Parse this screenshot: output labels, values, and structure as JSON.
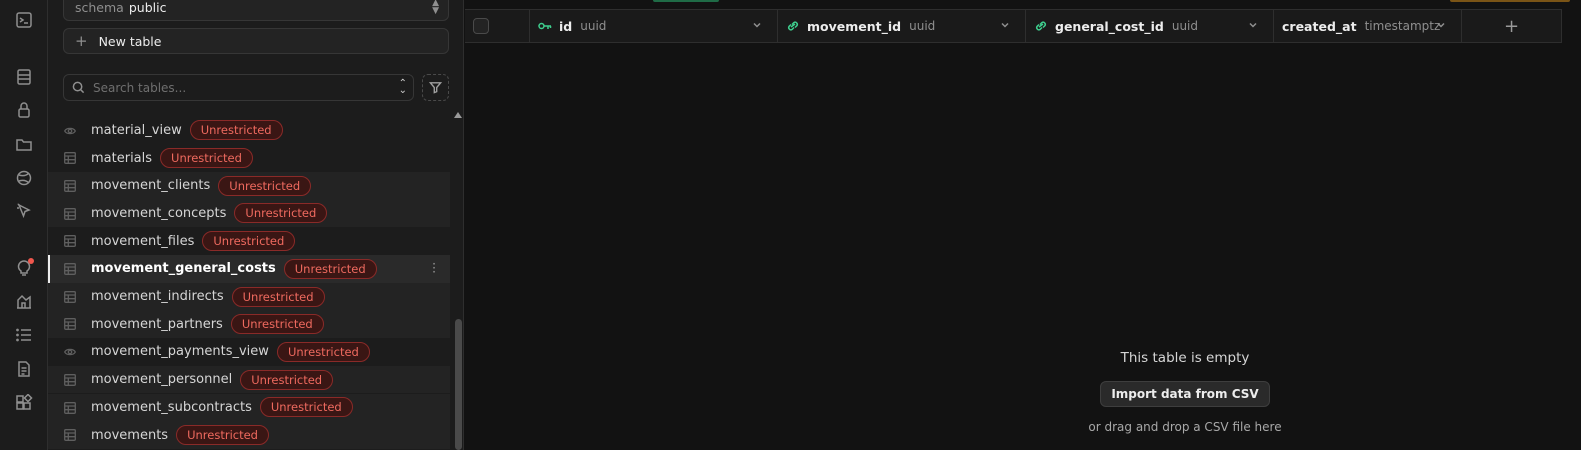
{
  "colors": {
    "accent_green": "#3ecf8e",
    "link_green": "#3ecf8e",
    "badge_red": "#ef6a5f",
    "badge_bg": "#3a1614",
    "notification_red": "#f0574d",
    "warning_orange": "#f5a623"
  },
  "rail": {
    "icons": [
      "terminal-icon",
      "database-icon",
      "lock-icon",
      "storage-icon",
      "realtime-icon",
      "edge-function-icon",
      "advisor-icon",
      "reports-icon",
      "logs-icon",
      "docs-icon",
      "integrations-icon"
    ]
  },
  "sidebar": {
    "schema_label": "schema",
    "schema_value": "public",
    "new_table_label": "New table",
    "search_placeholder": "Search tables...",
    "tables": [
      {
        "name": "material_view",
        "type": "view",
        "badge": "Unrestricted"
      },
      {
        "name": "materials",
        "type": "table",
        "badge": "Unrestricted"
      },
      {
        "name": "movement_clients",
        "type": "table",
        "badge": "Unrestricted"
      },
      {
        "name": "movement_concepts",
        "type": "table",
        "badge": "Unrestricted"
      },
      {
        "name": "movement_files",
        "type": "table",
        "badge": "Unrestricted"
      },
      {
        "name": "movement_general_costs",
        "type": "table",
        "badge": "Unrestricted",
        "selected": true
      },
      {
        "name": "movement_indirects",
        "type": "table",
        "badge": "Unrestricted"
      },
      {
        "name": "movement_partners",
        "type": "table",
        "badge": "Unrestricted"
      },
      {
        "name": "movement_payments_view",
        "type": "view",
        "badge": "Unrestricted"
      },
      {
        "name": "movement_personnel",
        "type": "table",
        "badge": "Unrestricted"
      },
      {
        "name": "movement_subcontracts",
        "type": "table",
        "badge": "Unrestricted"
      },
      {
        "name": "movements",
        "type": "table",
        "badge": "Unrestricted"
      }
    ]
  },
  "grid": {
    "columns": [
      {
        "name": "id",
        "type": "uuid",
        "icon": "primary-key-icon"
      },
      {
        "name": "movement_id",
        "type": "uuid",
        "icon": "foreign-key-link-icon"
      },
      {
        "name": "general_cost_id",
        "type": "uuid",
        "icon": "foreign-key-link-icon"
      },
      {
        "name": "created_at",
        "type": "timestamptz",
        "icon": ""
      }
    ],
    "add_column_label": "+",
    "empty": {
      "title": "This table is empty",
      "button_label": "Import data from CSV",
      "hint": "or drag and drop a CSV file here"
    }
  }
}
